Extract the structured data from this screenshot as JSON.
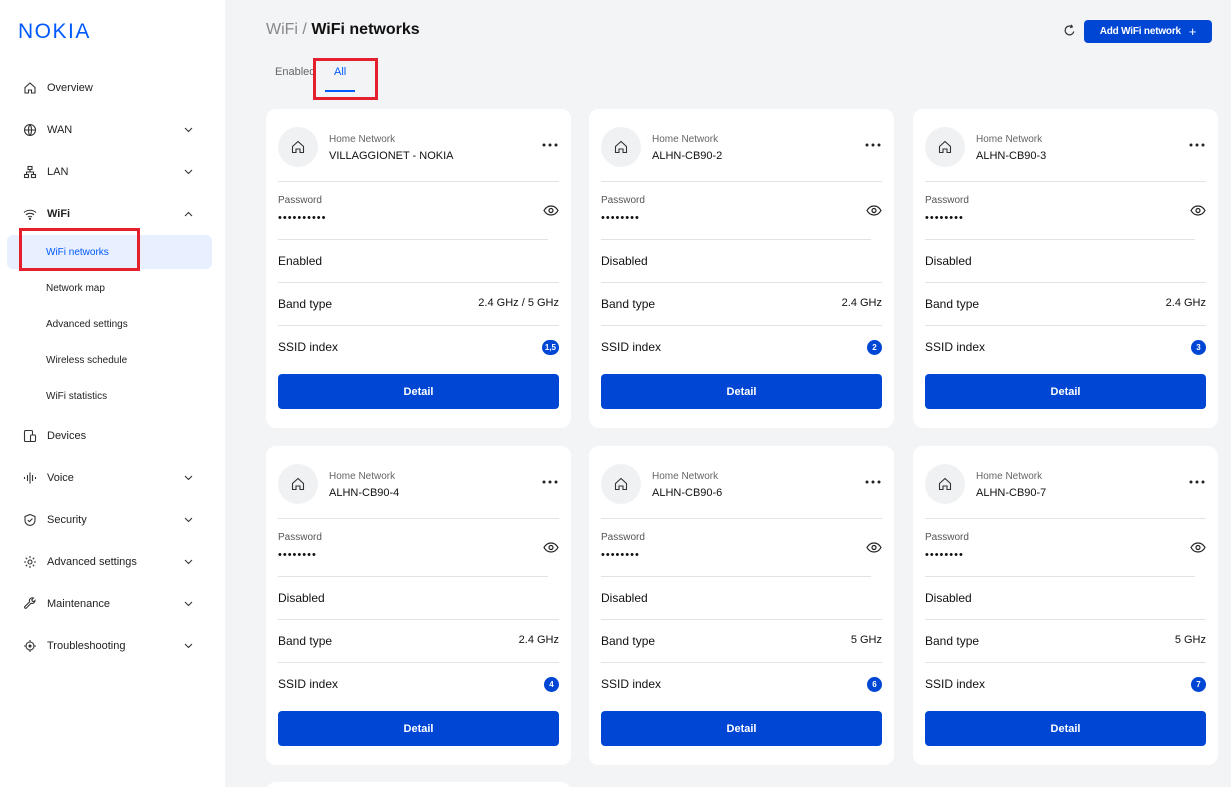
{
  "brand": {
    "logo": "NOKIA",
    "accent": "#005aff",
    "button": "#0046d5",
    "highlight": "#e4202e"
  },
  "sidebar": {
    "items": [
      {
        "label": "Overview",
        "icon": "home-icon",
        "expandable": false
      },
      {
        "label": "WAN",
        "icon": "globe-icon",
        "expandable": true
      },
      {
        "label": "LAN",
        "icon": "network-icon",
        "expandable": true
      },
      {
        "label": "WiFi",
        "icon": "wifi-icon",
        "expandable": true,
        "expanded": true
      }
    ],
    "wifi_sub": [
      {
        "label": "WiFi networks",
        "active": true
      },
      {
        "label": "Network map"
      },
      {
        "label": "Advanced settings"
      },
      {
        "label": "Wireless schedule"
      },
      {
        "label": "WiFi statistics"
      }
    ],
    "items_after": [
      {
        "label": "Devices",
        "icon": "devices-icon",
        "expandable": false
      },
      {
        "label": "Voice",
        "icon": "voice-icon",
        "expandable": true
      },
      {
        "label": "Security",
        "icon": "shield-icon",
        "expandable": true
      },
      {
        "label": "Advanced settings",
        "icon": "gear-icon",
        "expandable": true
      },
      {
        "label": "Maintenance",
        "icon": "wrench-icon",
        "expandable": true
      },
      {
        "label": "Troubleshooting",
        "icon": "crosshair-icon",
        "expandable": true
      }
    ]
  },
  "header": {
    "breadcrumb_parent": "WiFi",
    "breadcrumb_sep": " / ",
    "breadcrumb_current": "WiFi networks",
    "add_button": "Add WiFi network",
    "add_plus": "+"
  },
  "tabs": {
    "enabled": "Enabled",
    "all": "All",
    "active": "All"
  },
  "cards": [
    {
      "network_label": "Home Network",
      "name": "VILLAGGIONET - NOKIA",
      "password_label": "Password",
      "password": "••••••••••",
      "status": "Enabled",
      "band_label": "Band type",
      "band": "2.4 GHz / 5 GHz",
      "ssid_label": "SSID index",
      "ssid": "1,5",
      "detail": "Detail"
    },
    {
      "network_label": "Home Network",
      "name": "ALHN-CB90-2",
      "password_label": "Password",
      "password": "••••••••",
      "status": "Disabled",
      "band_label": "Band type",
      "band": "2.4 GHz",
      "ssid_label": "SSID index",
      "ssid": "2",
      "detail": "Detail"
    },
    {
      "network_label": "Home Network",
      "name": "ALHN-CB90-3",
      "password_label": "Password",
      "password": "••••••••",
      "status": "Disabled",
      "band_label": "Band type",
      "band": "2.4 GHz",
      "ssid_label": "SSID index",
      "ssid": "3",
      "detail": "Detail"
    },
    {
      "network_label": "Home Network",
      "name": "ALHN-CB90-4",
      "password_label": "Password",
      "password": "••••••••",
      "status": "Disabled",
      "band_label": "Band type",
      "band": "2.4 GHz",
      "ssid_label": "SSID index",
      "ssid": "4",
      "detail": "Detail"
    },
    {
      "network_label": "Home Network",
      "name": "ALHN-CB90-6",
      "password_label": "Password",
      "password": "••••••••",
      "status": "Disabled",
      "band_label": "Band type",
      "band": "5 GHz",
      "ssid_label": "SSID index",
      "ssid": "6",
      "detail": "Detail"
    },
    {
      "network_label": "Home Network",
      "name": "ALHN-CB90-7",
      "password_label": "Password",
      "password": "••••••••",
      "status": "Disabled",
      "band_label": "Band type",
      "band": "5 GHz",
      "ssid_label": "SSID index",
      "ssid": "7",
      "detail": "Detail"
    }
  ]
}
